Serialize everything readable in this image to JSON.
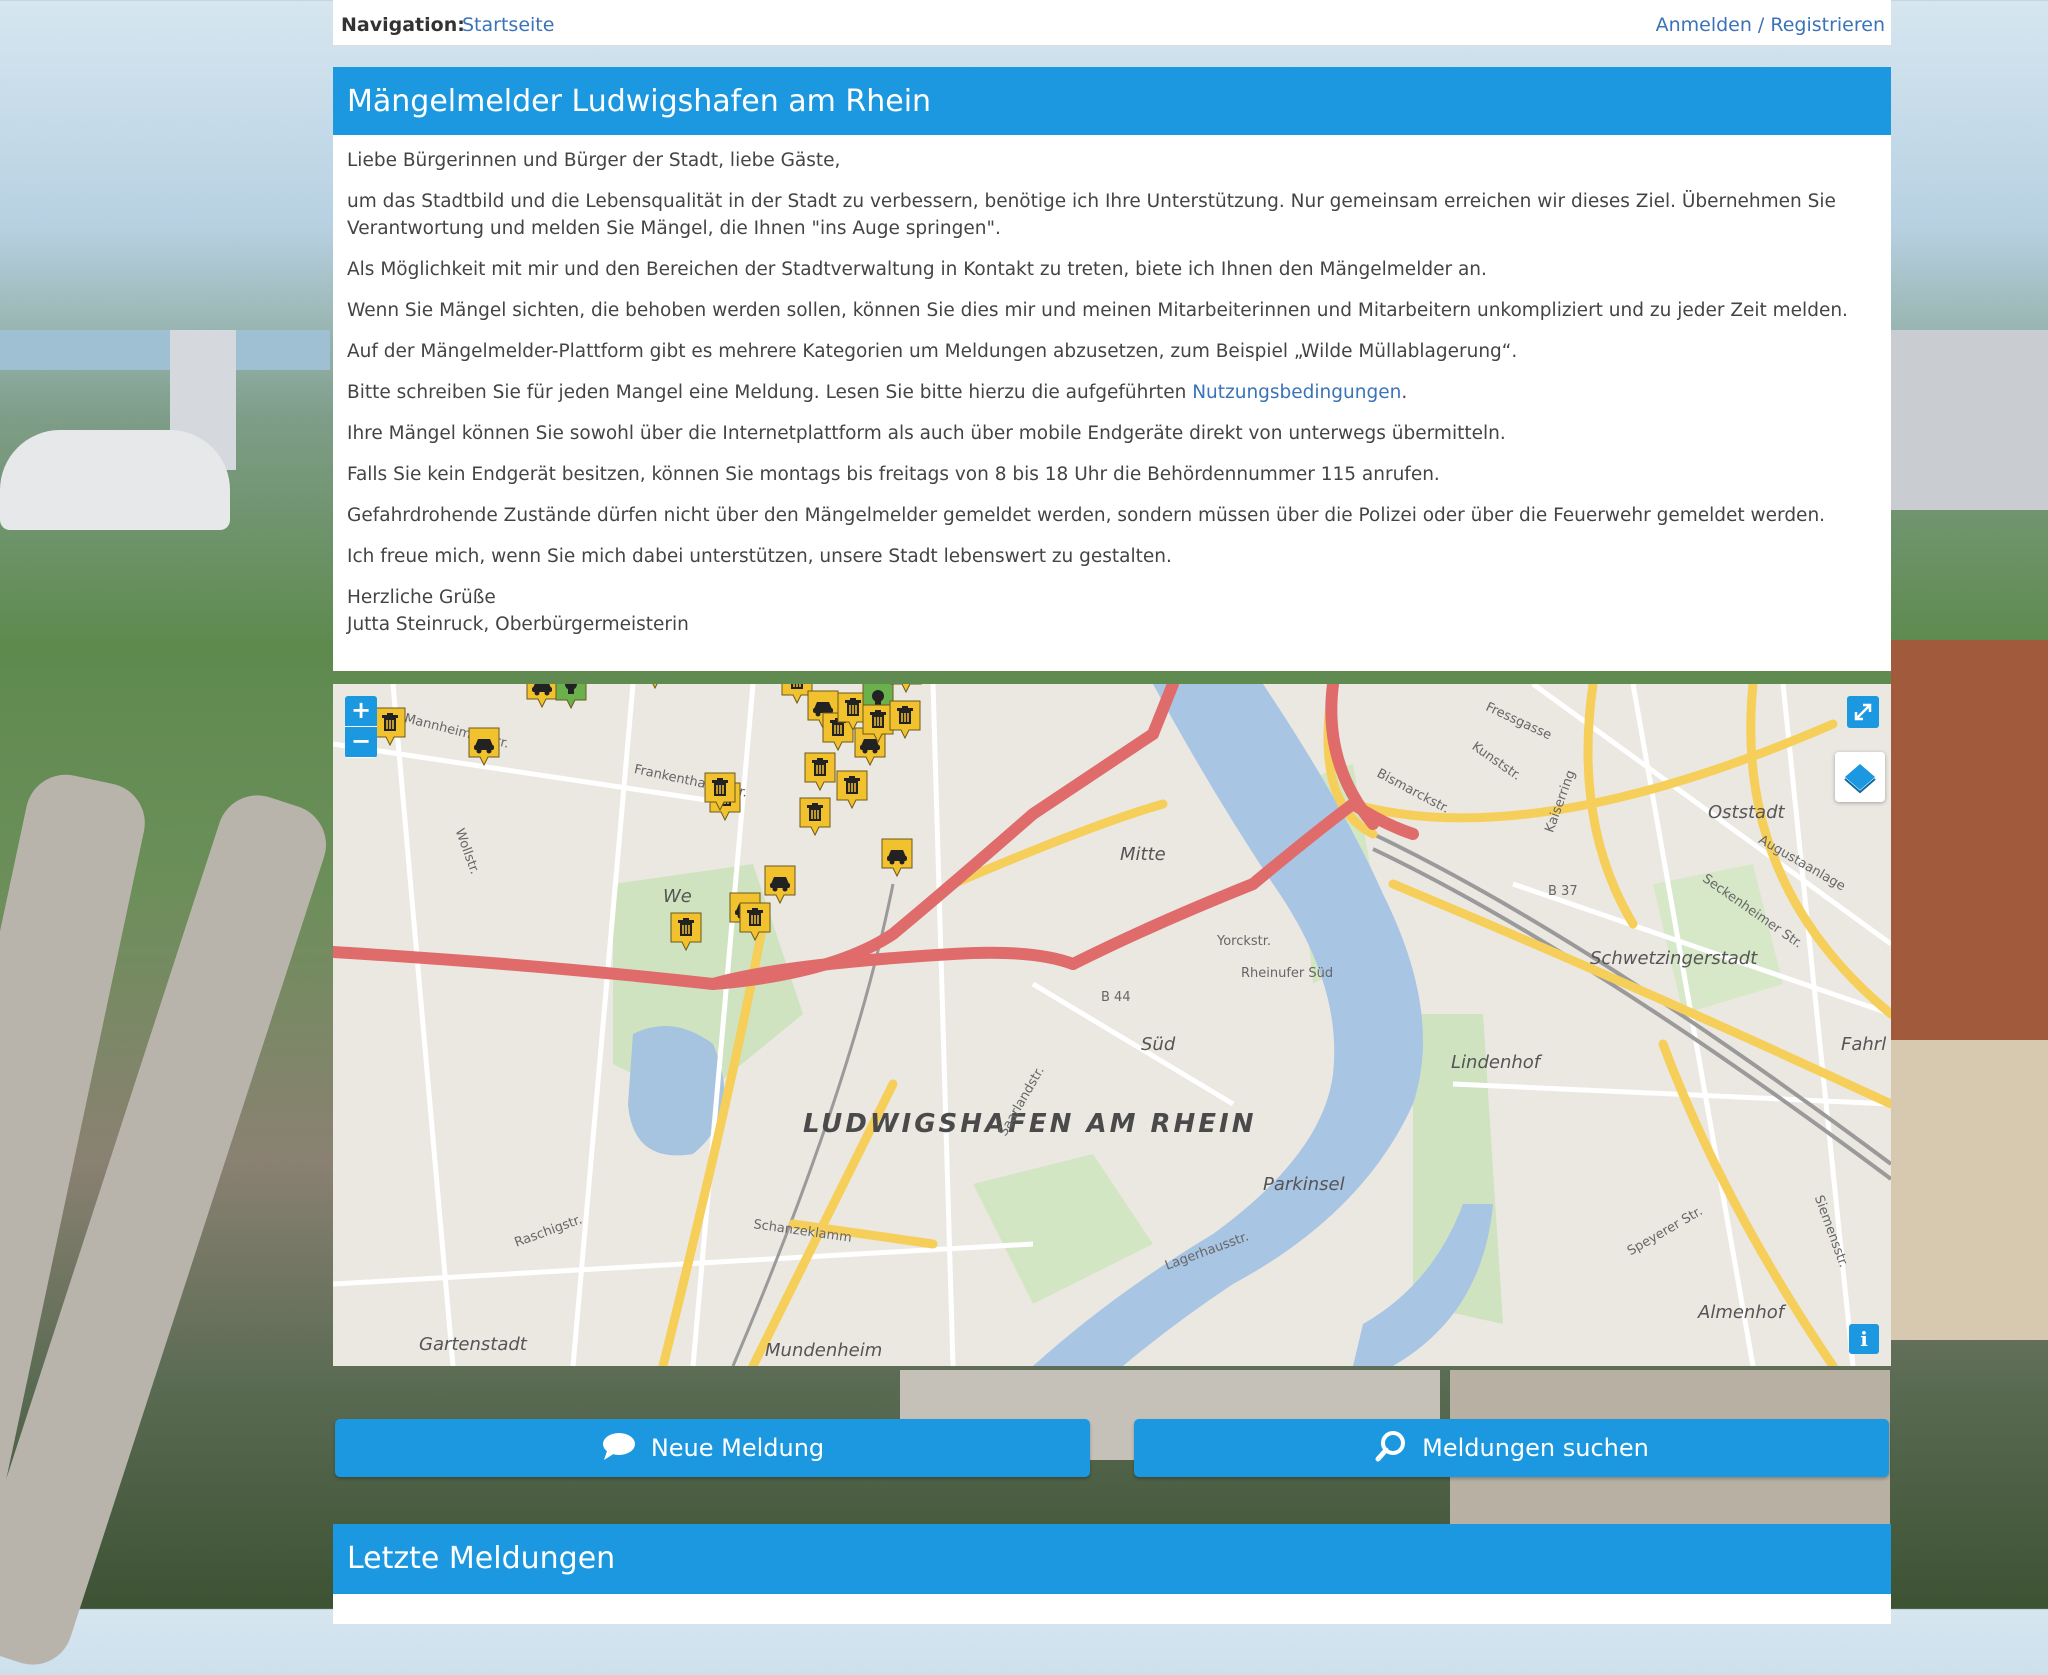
{
  "nav": {
    "label": "Navigation:",
    "home_link": "Startseite",
    "login_link": "Anmelden / Registrieren"
  },
  "intro": {
    "title": "Mängelmelder Ludwigshafen am Rhein",
    "greeting": "Liebe Bürgerinnen und Bürger der Stadt, liebe Gäste,",
    "p1": "um das Stadtbild und die Lebensqualität in der Stadt zu verbessern, benötige ich Ihre Unterstützung. Nur gemeinsam erreichen wir dieses Ziel. Übernehmen Sie Verantwortung und melden Sie Mängel, die Ihnen \"ins Auge springen\".",
    "p2": "Als Möglichkeit mit mir und den Bereichen der Stadtverwaltung in Kontakt zu treten, biete ich Ihnen den Mängelmelder an.",
    "p3": "Wenn Sie Mängel sichten, die behoben werden sollen, können Sie dies mir und meinen Mitarbeiterinnen und Mitarbeitern unkompliziert und zu jeder Zeit melden.",
    "p4": "Auf der Mängelmelder-Plattform gibt es mehrere Kategorien um Meldungen abzusetzen, zum Beispiel „Wilde Müllablagerung“.",
    "p5_before": "Bitte schreiben Sie für jeden Mangel eine Meldung. Lesen Sie bitte hierzu die aufgeführten ",
    "p5_link": "Nutzungsbedingungen",
    "p5_after": ".",
    "p6": "Ihre Mängel können Sie sowohl über die Internetplattform als auch über mobile Endgeräte direkt von unterwegs übermitteln.",
    "p7": "Falls Sie kein Endgerät besitzen, können Sie montags bis freitags von 8 bis 18 Uhr die Behördennummer 115 anrufen.",
    "p8": "Gefahrdrohende Zustände dürfen nicht über den Mängelmelder gemeldet werden, sondern müssen über die Polizei oder über die Feuerwehr gemeldet werden.",
    "p9": "Ich freue mich, wenn Sie mich dabei unterstützen, unsere Stadt lebenswert zu gestalten.",
    "closing": "Herzliche Grüße",
    "signature": "Jutta Steinruck, Oberbürgermeisterin"
  },
  "map": {
    "zoom_in": "+",
    "zoom_out": "−",
    "info": "i",
    "city_label": "LUDWIGSHAFEN AM RHEIN",
    "districts": [
      "Mitte",
      "Süd",
      "Oststadt",
      "Schwetzingerstadt",
      "Lindenhof",
      "Parkinsel",
      "Almenhof",
      "Gartenstadt",
      "Mundenheim",
      "Fahrl",
      "We"
    ],
    "streets": [
      "Mannheimer Str.",
      "Frankenthaler Str.",
      "Wollstr.",
      "Yorckstr.",
      "Rheinufer Süd",
      "Saarlandstr.",
      "Schanzeklamm",
      "Raschigstr.",
      "Bismarckstr.",
      "Augustaanlage",
      "Seckenheimer Str.",
      "Fressgasse",
      "Kunststr.",
      "Kaiserring",
      "Lagerhausstr.",
      "Speyerer Str.",
      "Siemensstr.",
      "B 37",
      "B 44"
    ],
    "marker_types": [
      "trash-marker",
      "car-marker",
      "lightbulb-marker"
    ]
  },
  "buttons": {
    "new_report": "Neue Meldung",
    "search_reports": "Meldungen suchen"
  },
  "recent": {
    "title": "Letzte Meldungen"
  },
  "colors": {
    "accent": "#1b98e0",
    "link": "#3a73b7",
    "marker_yellow": "#f2c12e",
    "marker_green": "#6ab04c"
  }
}
